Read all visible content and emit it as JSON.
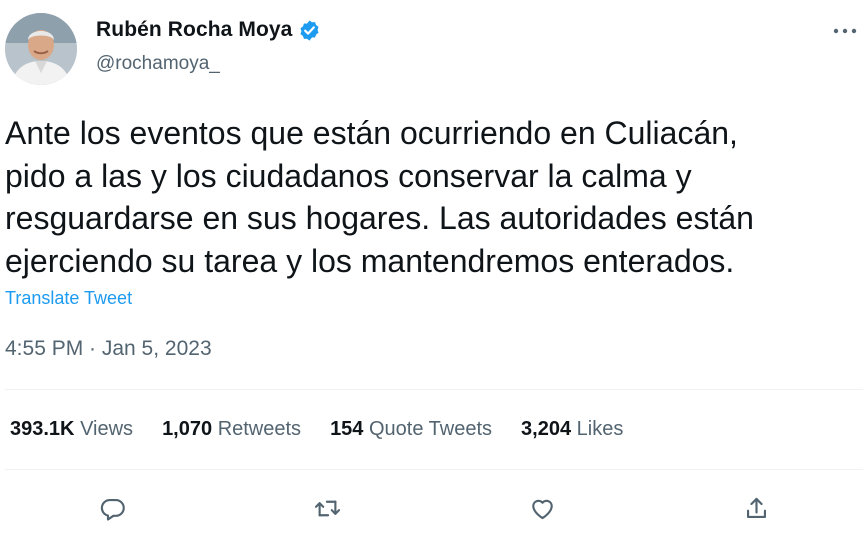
{
  "author": {
    "name": "Rubén Rocha Moya",
    "handle": "@rochamoya_",
    "verified_icon": "verified-badge-icon"
  },
  "tweet": {
    "text": "Ante los eventos que están ocurriendo en Culiacán,\npido a las y los ciudadanos conservar la calma y\nresguardarse en sus hogares. Las autoridades están\nejerciendo su tarea y los mantendremos enterados.",
    "translate_label": "Translate Tweet",
    "timestamp": "4:55 PM · Jan 5, 2023"
  },
  "stats": {
    "views": {
      "value": "393.1K",
      "label": "Views"
    },
    "retweets": {
      "value": "1,070",
      "label": "Retweets"
    },
    "quotes": {
      "value": "154",
      "label": "Quote Tweets"
    },
    "likes": {
      "value": "3,204",
      "label": "Likes"
    }
  },
  "actions": [
    "reply-icon",
    "retweet-icon",
    "like-icon",
    "share-icon"
  ],
  "colors": {
    "accent": "#1d9bf0",
    "text": "#0f1419",
    "secondary": "#536471",
    "icon": "#536471",
    "divider": "#eff3f4"
  }
}
